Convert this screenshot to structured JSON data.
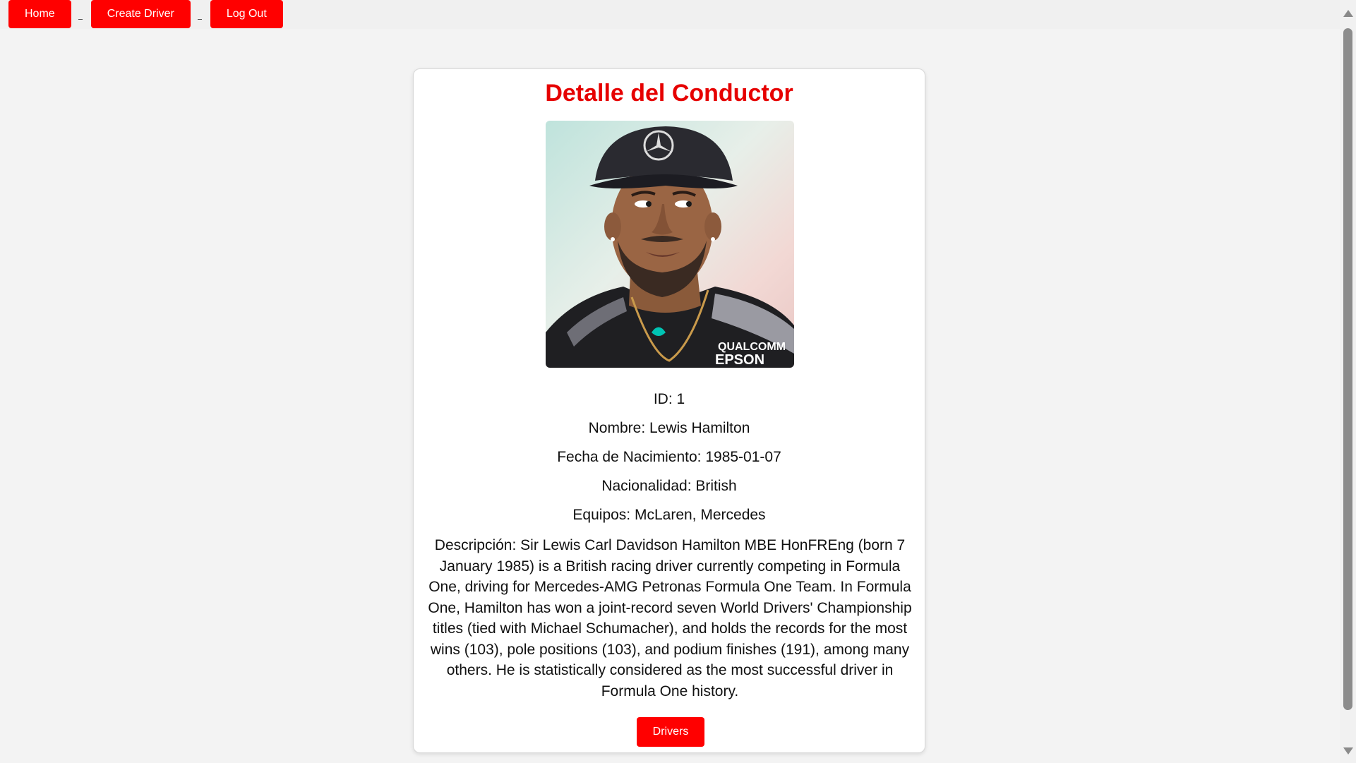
{
  "nav": {
    "home_label": "Home",
    "create_label": "Create Driver",
    "logout_label": "Log Out"
  },
  "card": {
    "title": "Detalle del Conductor",
    "photo_alt": "Lewis Hamilton",
    "id_line": "ID: 1",
    "name_line": "Nombre: Lewis Hamilton",
    "dob_line": "Fecha de Nacimiento: 1985-01-07",
    "nationality_line": "Nacionalidad: British",
    "teams_line": "Equipos: McLaren, Mercedes",
    "description": "Descripción: Sir Lewis Carl Davidson Hamilton MBE HonFREng (born 7 January 1985) is a British racing driver currently competing in Formula One, driving for Mercedes-AMG Petronas Formula One Team. In Formula One, Hamilton has won a joint-record seven World Drivers' Championship titles (tied with Michael Schumacher), and holds the records for the most wins (103), pole positions (103), and podium finishes (191), among many others. He is statistically considered as the most successful driver in Formula One history.",
    "drivers_button_label": "Drivers"
  },
  "colors": {
    "accent": "#ff0000",
    "title": "#e60000",
    "background": "#f3f3f3",
    "card": "#ffffff"
  }
}
